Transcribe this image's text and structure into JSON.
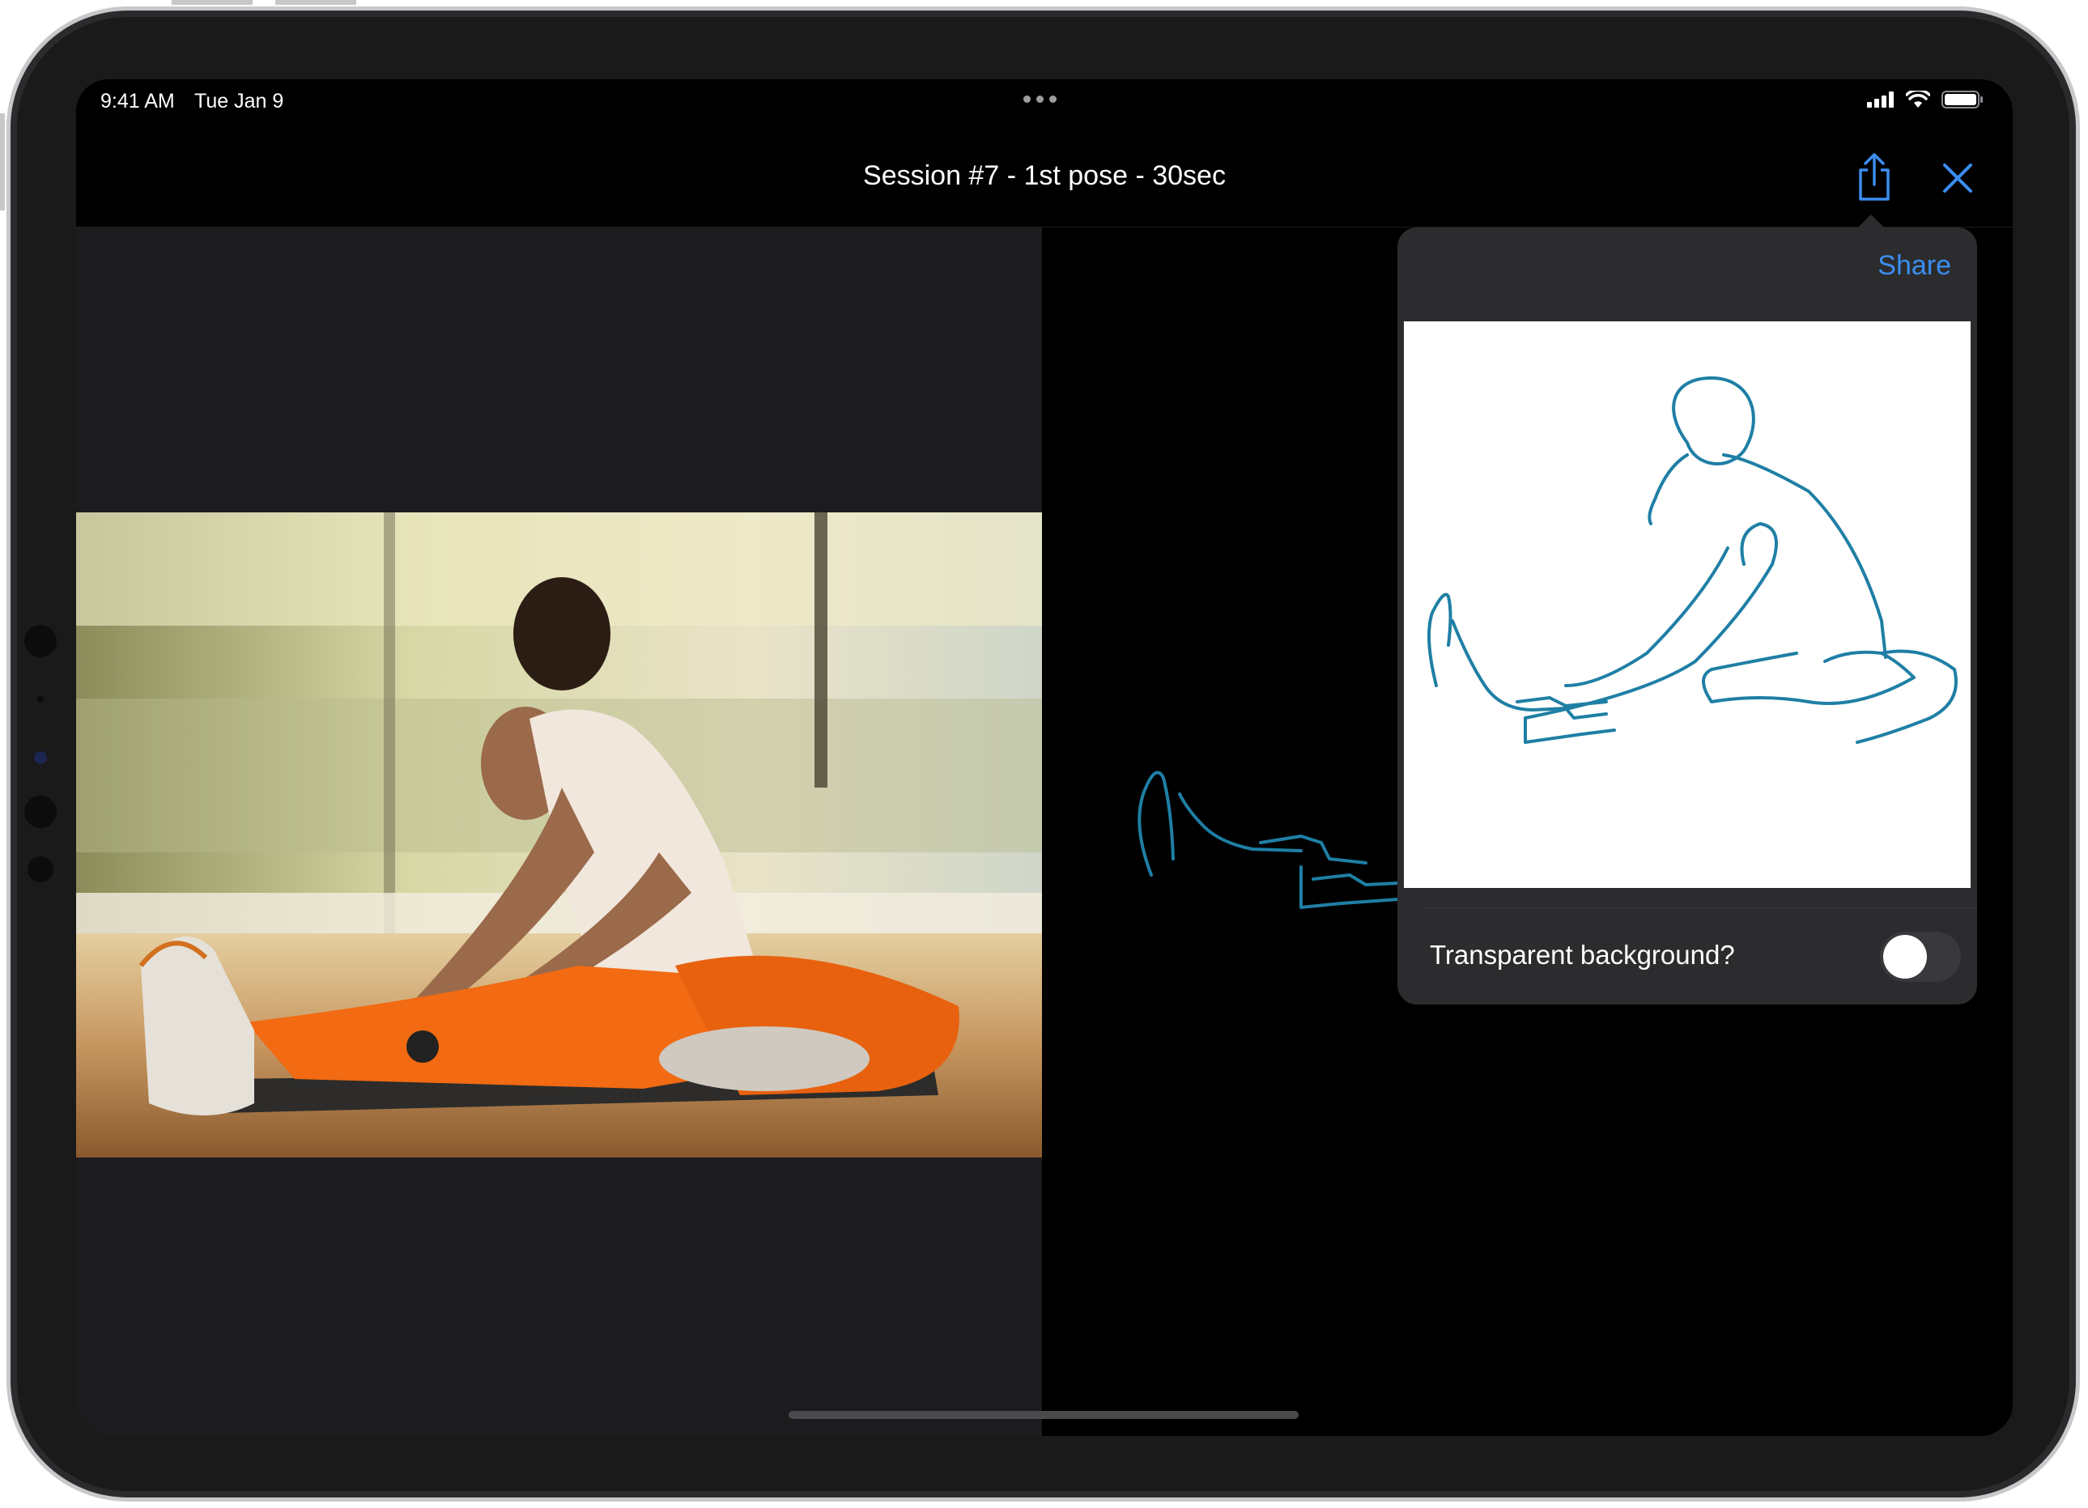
{
  "status_bar": {
    "time": "9:41 AM",
    "date": "Tue Jan 9"
  },
  "nav": {
    "title": "Session #7 - 1st pose - 30sec",
    "share_icon": "share-icon",
    "close_icon": "close-icon",
    "accent_color": "#3b8ef0"
  },
  "reference_photo": {
    "subject": "woman stretching seated on an exercise mat"
  },
  "popover": {
    "share_label": "Share",
    "toggle_label": "Transparent background?",
    "toggle_on": false
  },
  "colors": {
    "stroke": "#1f7fa5",
    "left_pane_bg": "#1c1c1e",
    "popover_bg": "#2c2c2e"
  }
}
